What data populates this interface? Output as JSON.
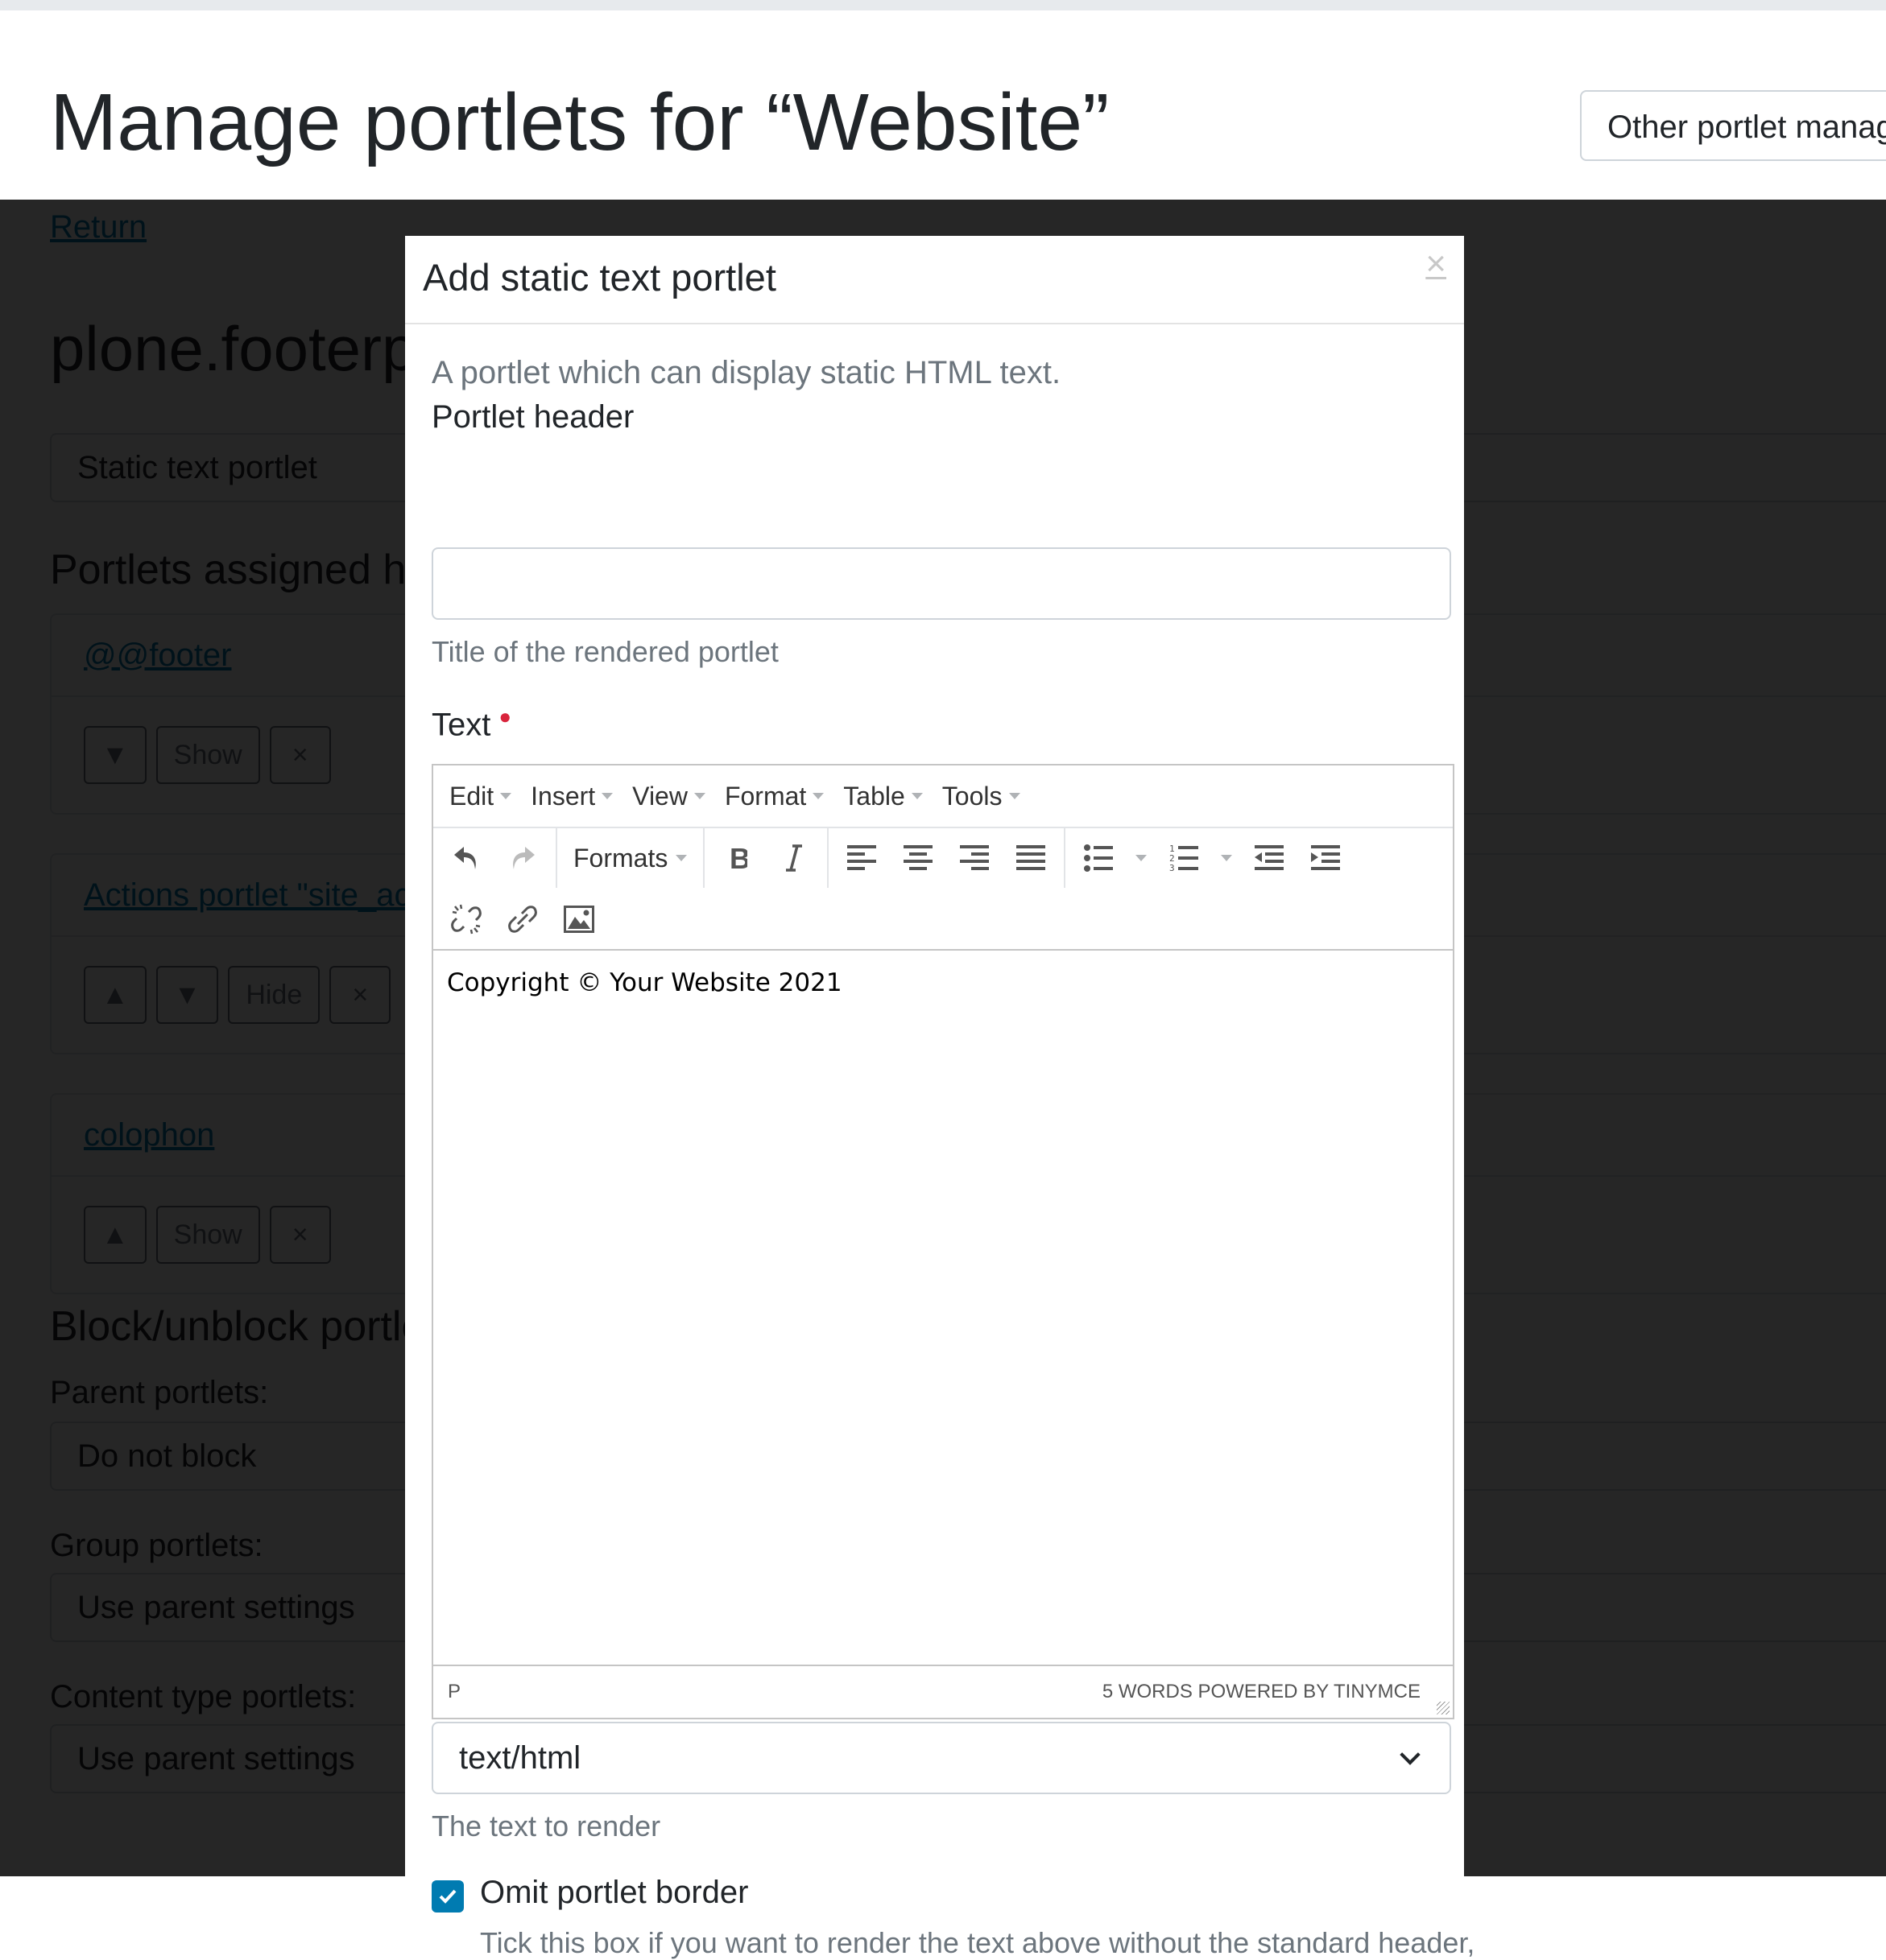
{
  "page": {
    "title": "Manage portlets for “Website”",
    "other_managers_button": "Other portlet managers"
  },
  "background": {
    "return_link": "Return",
    "manager_heading": "plone.footerportlets",
    "add_portlet_select": "Static text portlet",
    "assigned_heading": "Portlets assigned here",
    "portlets": [
      {
        "title": "@@footer",
        "buttons": [
          "▼",
          "Show",
          "×"
        ]
      },
      {
        "title": "Actions portlet \"site_actions\"",
        "buttons": [
          "▲",
          "▼",
          "Hide",
          "×"
        ]
      },
      {
        "title": "colophon",
        "buttons": [
          "▲",
          "Show",
          "×"
        ]
      }
    ],
    "block_heading": "Block/unblock portlets",
    "block_settings": [
      {
        "label": "Parent portlets:",
        "value": "Do not block"
      },
      {
        "label": "Group portlets:",
        "value": "Use parent settings"
      },
      {
        "label": "Content type portlets:",
        "value": "Use parent settings"
      }
    ]
  },
  "modal": {
    "title": "Add static text portlet",
    "close_label": "×",
    "description": "A portlet which can display static HTML text.",
    "portlet_header": {
      "label": "Portlet header",
      "value": "",
      "help": "Title of the rendered portlet"
    },
    "text_field": {
      "label": "Text",
      "required": true,
      "help": "The text to render"
    },
    "editor": {
      "menubar": [
        "Edit",
        "Insert",
        "View",
        "Format",
        "Table",
        "Tools"
      ],
      "formats_label": "Formats",
      "toolbar_icons": [
        "undo-icon",
        "redo-icon",
        "bold-icon",
        "italic-icon",
        "align-left-icon",
        "align-center-icon",
        "align-right-icon",
        "align-justify-icon",
        "bullet-list-icon",
        "numbered-list-icon",
        "outdent-icon",
        "indent-icon",
        "unlink-icon",
        "link-icon",
        "image-icon"
      ],
      "content": "Copyright © Your Website 2021",
      "status_path": "P",
      "status_info": "5 WORDS POWERED BY TINYMCE"
    },
    "mime_type": {
      "selected": "text/html"
    },
    "omit_border": {
      "checked": true,
      "label": "Omit portlet border",
      "help": "Tick this box if you want to render the text above without the standard header,"
    }
  },
  "colors": {
    "accent": "#007bb1",
    "required": "#d9243c",
    "muted_text": "#6c757d",
    "overlay": "#262626"
  }
}
